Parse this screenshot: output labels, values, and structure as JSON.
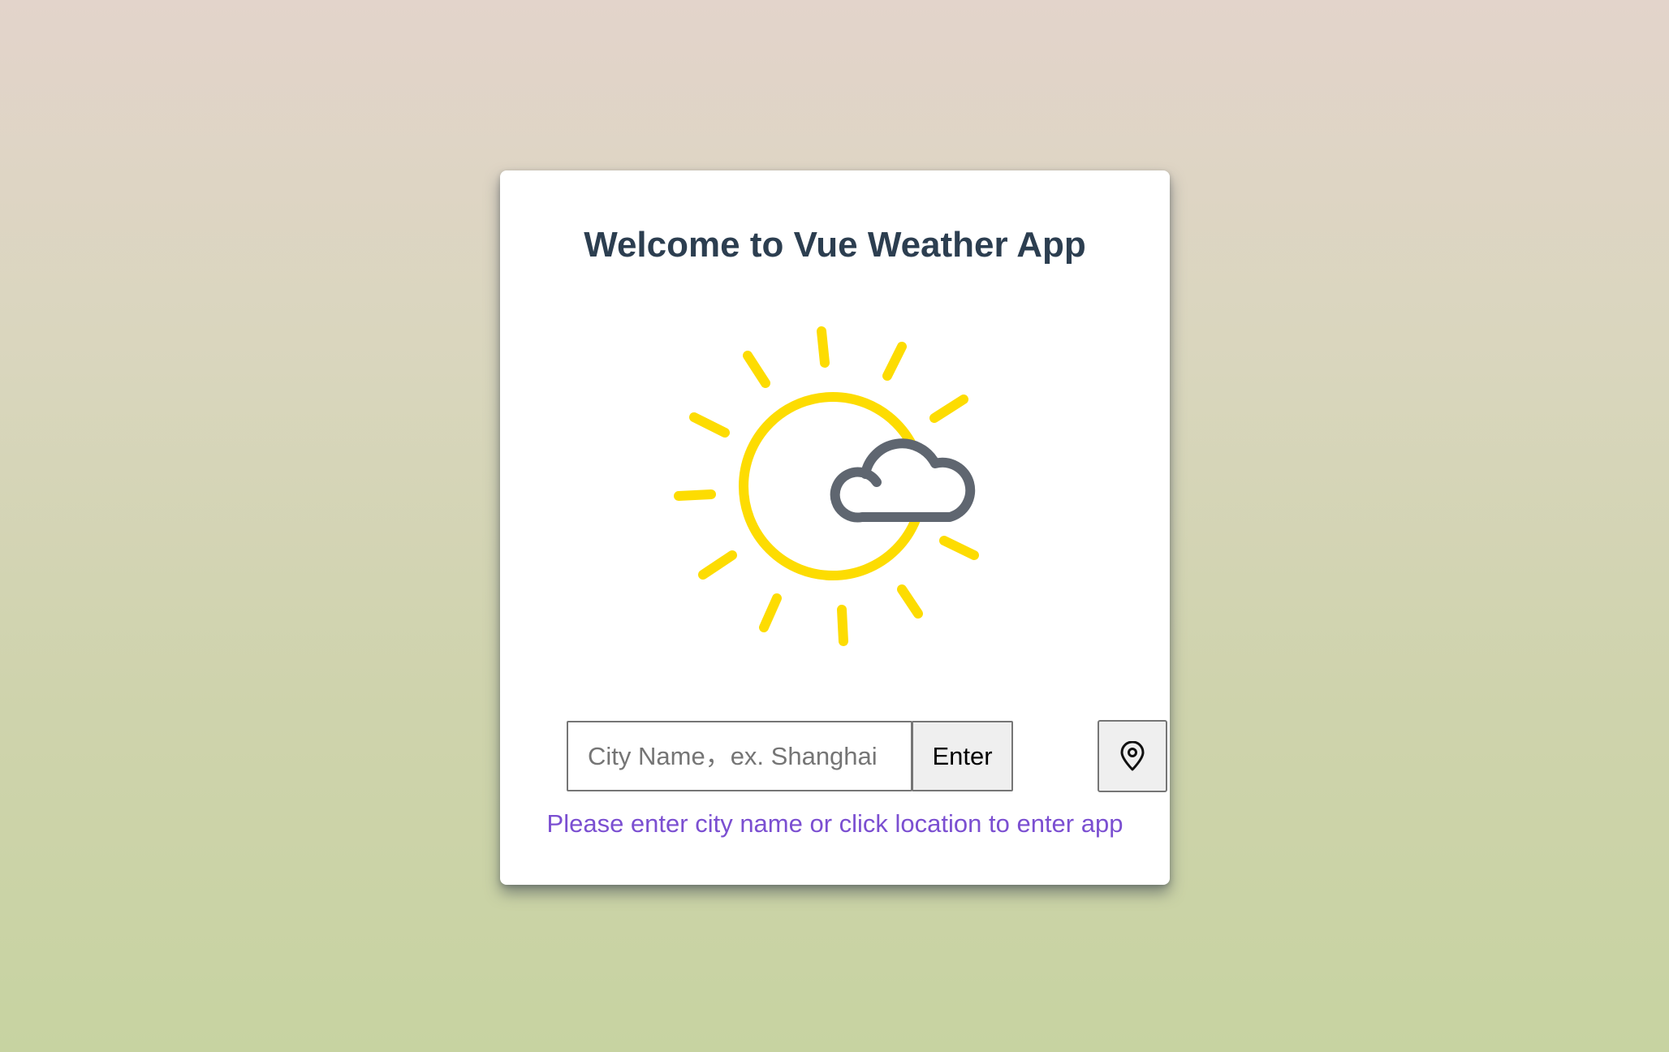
{
  "card": {
    "title": "Welcome to Vue Weather App",
    "illustration": "sun-cloud-icon"
  },
  "search": {
    "placeholder": "City Name，ex. Shanghai",
    "value": "",
    "enter_label": "Enter",
    "location_icon": "location-pin-icon"
  },
  "hint": "Please enter city name or click location to enter app",
  "colors": {
    "title": "#2c3e50",
    "sun": "#fddc01",
    "cloud": "#5f6670",
    "hint": "#7b4fd1",
    "card": "#ffffff"
  }
}
